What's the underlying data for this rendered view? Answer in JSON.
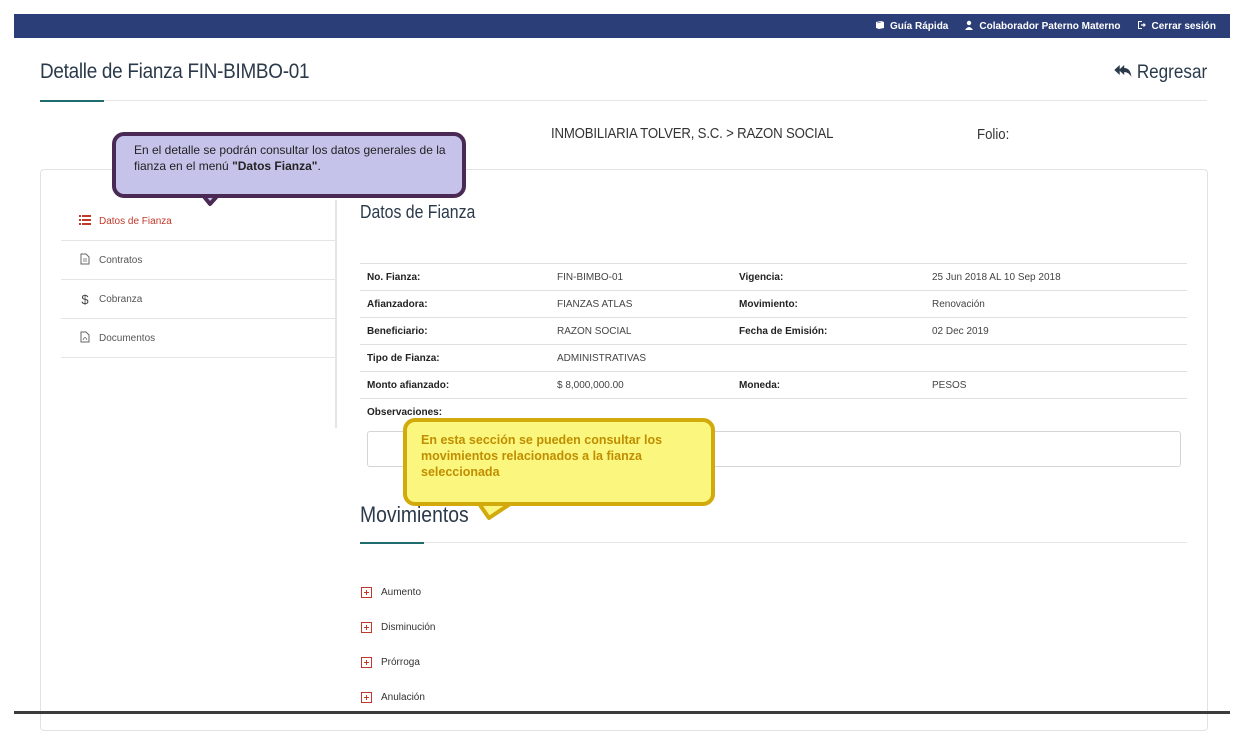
{
  "topbar": {
    "quick_guide": "Guía Rápida",
    "user": "Colaborador Paterno Materno",
    "logout": "Cerrar sesión",
    "bg_color": "#2c3e77"
  },
  "header": {
    "title": "Detalle de Fianza FIN-BIMBO-01",
    "back_label": "Regresar"
  },
  "context": {
    "company": "INMOBILIARIA TOLVER, S.C. > RAZON SOCIAL",
    "folio_label": "Folio:"
  },
  "sidebar": {
    "items": [
      {
        "label": "Datos de Fianza",
        "icon": "list-icon",
        "active": true
      },
      {
        "label": "Contratos",
        "icon": "document-icon",
        "active": false
      },
      {
        "label": "Cobranza",
        "icon": "dollar-icon",
        "active": false
      },
      {
        "label": "Documentos",
        "icon": "pdf-icon",
        "active": false
      }
    ]
  },
  "details": {
    "title": "Datos de Fianza",
    "rows": [
      {
        "label1": "No. Fianza:",
        "value1": "FIN-BIMBO-01",
        "label2": "Vigencia:",
        "value2": "25 Jun 2018 AL 10 Sep 2018"
      },
      {
        "label1": "Afianzadora:",
        "value1": "FIANZAS ATLAS",
        "label2": "Movimiento:",
        "value2": "Renovación"
      },
      {
        "label1": "Beneficiario:",
        "value1": "RAZON SOCIAL",
        "label2": "Fecha de Emisión:",
        "value2": "02 Dec 2019"
      },
      {
        "label1": "Tipo de Fianza:",
        "value1": "ADMINISTRATIVAS",
        "label2": "",
        "value2": ""
      },
      {
        "label1": "Monto afianzado:",
        "value1": "$ 8,000,000.00",
        "label2": "Moneda:",
        "value2": "PESOS"
      }
    ],
    "observations_label": "Observaciones:"
  },
  "movements": {
    "title": "Movimientos",
    "items": [
      "Aumento",
      "Disminución",
      "Prórroga",
      "Anulación"
    ]
  },
  "callouts": {
    "purple": {
      "text_prefix": "En el detalle se podrán consultar los datos generales de la fianza en el menú ",
      "text_bold": "\"Datos Fianza\"",
      "text_suffix": "."
    },
    "yellow": {
      "text": "En esta sección se pueden consultar los movimientos relacionados a la fianza seleccionada"
    }
  },
  "colors": {
    "accent_red": "#c0392b",
    "accent_teal": "#1f6b6e"
  }
}
